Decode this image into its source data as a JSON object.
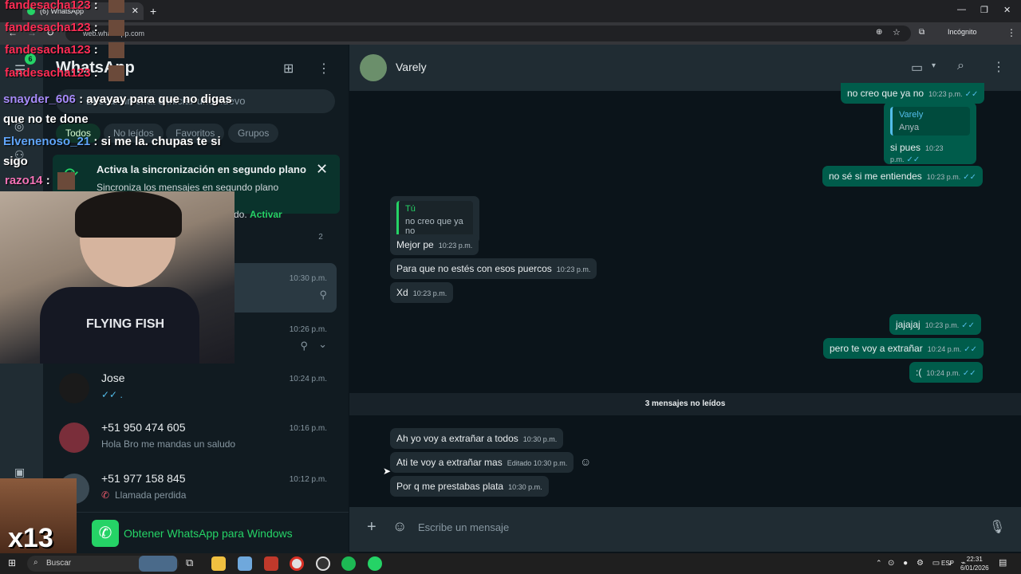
{
  "browser": {
    "tab_title": "(6) WhatsApp",
    "url": "web.whatsapp.com",
    "incognito_label": "Incógnito"
  },
  "sidebar": {
    "badge_count": "6",
    "title": "WhatsApp",
    "search_placeholder": "Buscar un chat o iniciar uno nuevo",
    "filters": [
      "Todos",
      "No leídos",
      "Favoritos",
      "Grupos"
    ],
    "banner": {
      "title": "Activa la sincronización en segundo plano",
      "text": "Sincroniza los mensajes en segundo plano para",
      "text2": "do.",
      "link": "Activar"
    },
    "chats": [
      {
        "name": "",
        "msg": "",
        "time": "",
        "badge": "2"
      },
      {
        "name": "",
        "msg": "",
        "time": "10:30 p.m."
      },
      {
        "name": "",
        "msg": "",
        "time": "10:26 p.m."
      },
      {
        "name": "Jose",
        "msg": "✓✓ .",
        "time": "10:24 p.m."
      },
      {
        "name": "+51 950 474 605",
        "msg": "Hola Bro me mandas un saludo",
        "time": "10:16 p.m."
      },
      {
        "name": "+51 977 158 845",
        "msg": "Llamada perdida",
        "time": "10:12 p.m."
      }
    ],
    "get_app": "Obtener WhatsApp para Windows"
  },
  "chat": {
    "contact_name": "Varely",
    "messages": [
      {
        "dir": "out",
        "text": "no creo que ya no",
        "time": "10:23 p.m."
      },
      {
        "dir": "out",
        "quote_author": "Varely",
        "quote_text": "Anya",
        "text": "si pues",
        "time": "10:23 p.m."
      },
      {
        "dir": "out",
        "text": "no sé si me entiendes",
        "time": "10:23 p.m."
      },
      {
        "dir": "in",
        "quote_author": "Tú",
        "quote_text": "no creo que ya no",
        "text": "Mejor pe",
        "time": "10:23 p.m."
      },
      {
        "dir": "in",
        "text": "Para que no estés con esos puercos",
        "time": "10:23 p.m."
      },
      {
        "dir": "in",
        "text": "Xd",
        "time": "10:23 p.m."
      },
      {
        "dir": "out",
        "text": "jajajaj",
        "time": "10:23 p.m."
      },
      {
        "dir": "out",
        "text": "pero te voy a extrañar",
        "time": "10:24 p.m."
      },
      {
        "dir": "out",
        "text": ":(",
        "time": "10:24 p.m."
      },
      {
        "dir": "in",
        "text": "Ah yo voy a extrañar a todos",
        "time": "10:30 p.m."
      },
      {
        "dir": "in",
        "text": "Ati te voy a extrañar mas",
        "time": "Editado 10:30 p.m."
      },
      {
        "dir": "in",
        "text": "Por q me prestabas plata",
        "time": "10:30 p.m."
      }
    ],
    "unread_divider": "3 mensajes no leídos",
    "composer_placeholder": "Escribe un mensaje"
  },
  "stream_overlay": {
    "chat_lines": [
      {
        "user": "fandesacha123",
        "text": ":"
      },
      {
        "user": "fandesacha123",
        "text": ":"
      },
      {
        "user": "fandesacha123",
        "text": ":"
      },
      {
        "user": "fandesacha123",
        "text": ":"
      },
      {
        "user": "snayder_606",
        "text": ": ayayay para que no digas que no te done"
      },
      {
        "user": "Elvenenoso_21",
        "text": ": si me la. chupas te si sigo"
      },
      {
        "user": "razo14",
        "text": ":"
      }
    ],
    "shirt_text": "FLYING FISH",
    "emote_label": "x13"
  },
  "taskbar": {
    "search_label": "Buscar",
    "lang": "ESP",
    "time": "22:31",
    "date": "6/01/2026"
  },
  "colors": {
    "accent": "#25d366",
    "outgoing_bubble": "#005c4b",
    "incoming_bubble": "#202c33",
    "background": "#0b141a"
  }
}
